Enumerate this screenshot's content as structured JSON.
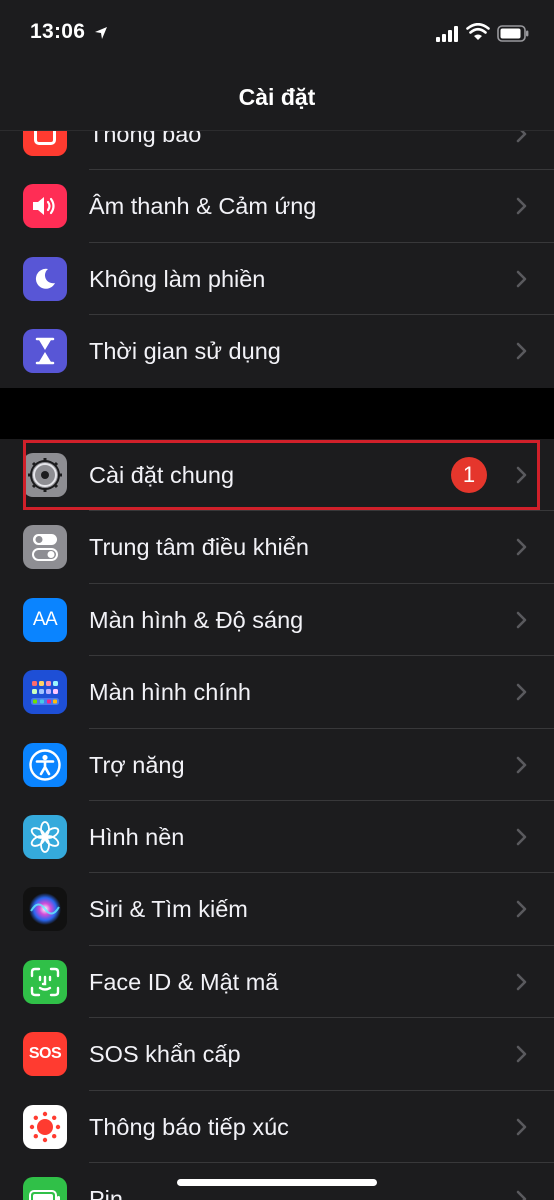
{
  "status": {
    "time": "13:06"
  },
  "nav": {
    "title": "Cài đặt"
  },
  "group1": [
    {
      "label": "Thông báo",
      "icon": "notifications-icon",
      "color": "#ff3b30"
    },
    {
      "label": "Âm thanh & Cảm ứng",
      "icon": "speaker-icon",
      "color": "#ff2d55"
    },
    {
      "label": "Không làm phiền",
      "icon": "moon-icon",
      "color": "#5856d6"
    },
    {
      "label": "Thời gian sử dụng",
      "icon": "hourglass-icon",
      "color": "#5856d6"
    }
  ],
  "group2": [
    {
      "label": "Cài đặt chung",
      "icon": "gear-icon",
      "color": "#8e8e93",
      "badge": "1"
    },
    {
      "label": "Trung tâm điều khiển",
      "icon": "toggles-icon",
      "color": "#8e8e93"
    },
    {
      "label": "Màn hình & Độ sáng",
      "icon": "display-aa-icon",
      "color": "#0a84ff",
      "icon_text": "AA"
    },
    {
      "label": "Màn hình chính",
      "icon": "home-screen-icon",
      "color": "#1e4fd6"
    },
    {
      "label": "Trợ năng",
      "icon": "accessibility-icon",
      "color": "#0a84ff"
    },
    {
      "label": "Hình nền",
      "icon": "wallpaper-flower-icon",
      "color": "#35aadc"
    },
    {
      "label": "Siri & Tìm kiếm",
      "icon": "siri-icon",
      "color": "#1a1a2e"
    },
    {
      "label": "Face ID & Mật mã",
      "icon": "face-id-icon",
      "color": "#30c048"
    },
    {
      "label": "SOS khẩn cấp",
      "icon": "sos-icon",
      "color": "#ff3b30",
      "icon_text": "SOS"
    },
    {
      "label": "Thông báo tiếp xúc",
      "icon": "exposure-notification-icon",
      "color": "#ffffff"
    },
    {
      "label": "Pin",
      "icon": "battery-settings-icon",
      "color": "#30c048"
    }
  ]
}
